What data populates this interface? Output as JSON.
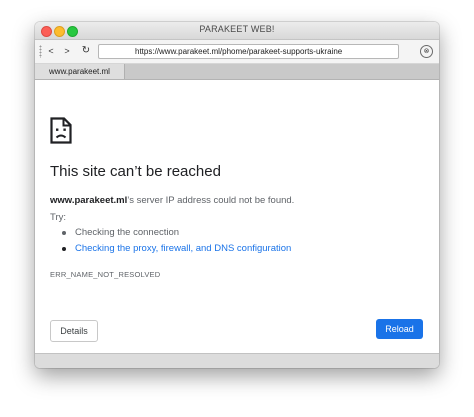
{
  "window": {
    "title": "PARAKEET WEB!"
  },
  "toolbar": {
    "back_glyph": "<",
    "forward_glyph": ">",
    "reload_glyph": "↻",
    "url": "https://www.parakeet.ml/phome/parakeet-supports-ukraine",
    "close_glyph": "⊗"
  },
  "tabs": [
    {
      "label": "www.parakeet.ml"
    }
  ],
  "error_page": {
    "headline": "This site can’t be reached",
    "host": "www.parakeet.ml",
    "message_rest": "’s server IP address could not be found.",
    "try_label": "Try:",
    "suggestions": [
      {
        "label": "Checking the connection"
      },
      {
        "label": "Checking the proxy, firewall, and DNS configuration"
      }
    ],
    "error_code": "ERR_NAME_NOT_RESOLVED",
    "details_button": "Details",
    "reload_button": "Reload"
  },
  "icons": {
    "sad_page": "sad-document-icon"
  },
  "colors": {
    "accent": "#1a73e8",
    "text_primary": "#202124",
    "text_secondary": "#5f6368"
  }
}
